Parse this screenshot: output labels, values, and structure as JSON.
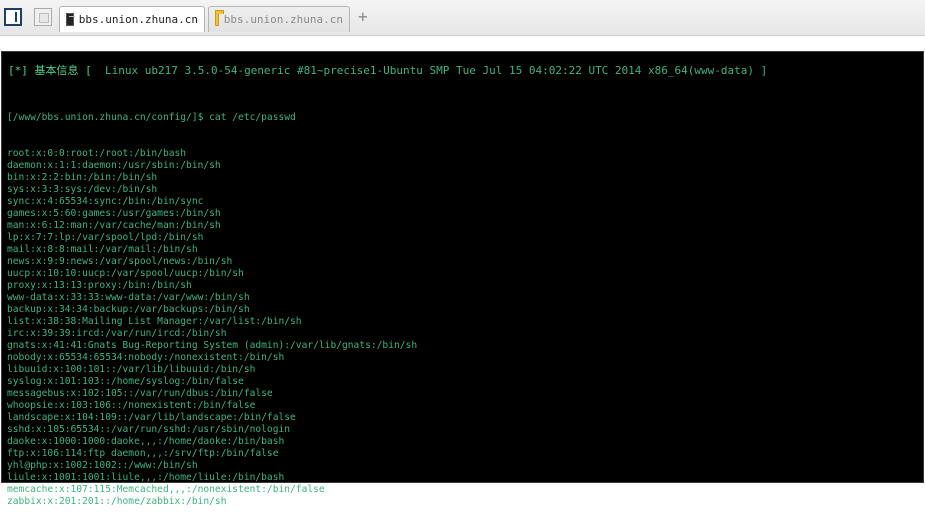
{
  "tabs": [
    {
      "label": "bbs.union.zhuna.cn",
      "icon": "terminal-icon",
      "active": true
    },
    {
      "label": "bbs.union.zhuna.cn",
      "icon": "folder-icon",
      "active": false
    }
  ],
  "new_tab_symbol": "+",
  "terminal": {
    "sysinfo_label": "[*] 基本信息 [",
    "sysinfo_value": "  Linux ub217 3.5.0-54-generic #81~precise1-Ubuntu SMP Tue Jul 15 04:02:22 UTC 2014 x86_64(www-data) ]",
    "prompt": "[/www/bbs.union.zhuna.cn/config/]$ cat /etc/passwd",
    "lines": [
      "root:x:0:0:root:/root:/bin/bash",
      "daemon:x:1:1:daemon:/usr/sbin:/bin/sh",
      "bin:x:2:2:bin:/bin:/bin/sh",
      "sys:x:3:3:sys:/dev:/bin/sh",
      "sync:x:4:65534:sync:/bin:/bin/sync",
      "games:x:5:60:games:/usr/games:/bin/sh",
      "man:x:6:12:man:/var/cache/man:/bin/sh",
      "lp:x:7:7:lp:/var/spool/lpd:/bin/sh",
      "mail:x:8:8:mail:/var/mail:/bin/sh",
      "news:x:9:9:news:/var/spool/news:/bin/sh",
      "uucp:x:10:10:uucp:/var/spool/uucp:/bin/sh",
      "proxy:x:13:13:proxy:/bin:/bin/sh",
      "www-data:x:33:33:www-data:/var/www:/bin/sh",
      "backup:x:34:34:backup:/var/backups:/bin/sh",
      "list:x:38:38:Mailing List Manager:/var/list:/bin/sh",
      "irc:x:39:39:ircd:/var/run/ircd:/bin/sh",
      "gnats:x:41:41:Gnats Bug-Reporting System (admin):/var/lib/gnats:/bin/sh",
      "nobody:x:65534:65534:nobody:/nonexistent:/bin/sh",
      "libuuid:x:100:101::/var/lib/libuuid:/bin/sh",
      "syslog:x:101:103::/home/syslog:/bin/false",
      "messagebus:x:102:105::/var/run/dbus:/bin/false",
      "whoopsie:x:103:106::/nonexistent:/bin/false",
      "landscape:x:104:109::/var/lib/landscape:/bin/false",
      "sshd:x:105:65534::/var/run/sshd:/usr/sbin/nologin",
      "daoke:x:1000:1000:daoke,,,:/home/daoke:/bin/bash",
      "ftp:x:106:114:ftp daemon,,,:/srv/ftp:/bin/false",
      "yhl@php:x:1002:1002::/www:/bin/sh",
      "liule:x:1001:1001:liule,,,:/home/liule:/bin/bash",
      "memcache:x:107:115:Memcached,,,:/nonexistent:/bin/false",
      "zabbix:x:201:201::/home/zabbix:/bin/sh"
    ]
  }
}
